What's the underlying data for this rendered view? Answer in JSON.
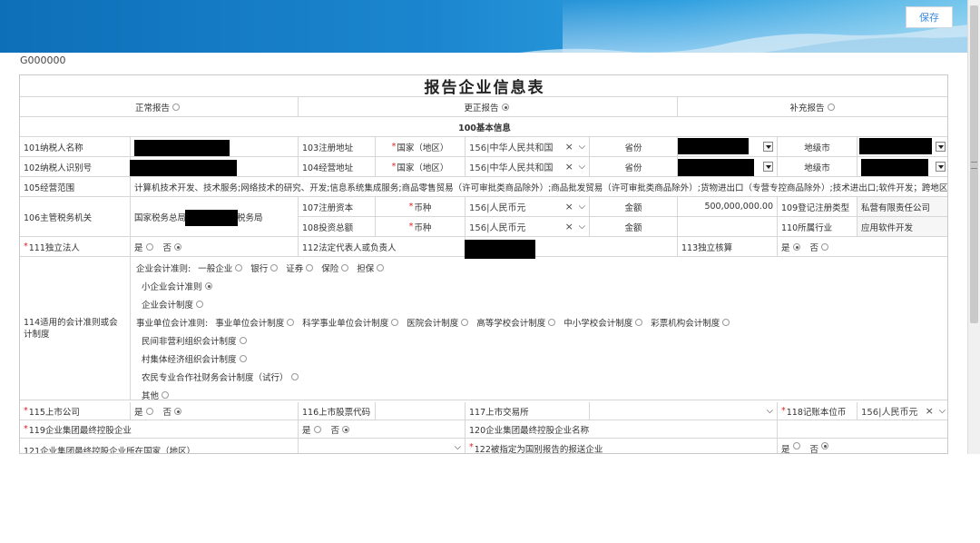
{
  "header": {
    "save_label": "保存"
  },
  "form_code": "G000000",
  "form": {
    "title": "报告企业信息表",
    "report_types": [
      "正常报告",
      "更正报告",
      "补充报告"
    ],
    "section_100": "100基本信息",
    "r101_label": "101纳税人名称",
    "r102_label": "102纳税人识别号",
    "r103_label": "103注册地址",
    "r104_label": "104经营地址",
    "country_label": "国家（地区）",
    "country_value": "156|中华人民共和国",
    "province_label": "省份",
    "city_label": "地级市",
    "r105_label": "105经营范围",
    "r105_value": "计算机技术开发、技术服务;网络技术的研究、开发;信息系统集成服务;商品零售贸易（许可审批类商品除外）;商品批发贸易（许可审批类商品除外）;货物进出口（专营专控商品除外）;技术进出口;软件开发；跨地区互",
    "r106_label": "106主管税务机关",
    "r106_prefix": "国家税务总局",
    "r106_suffix": "税务局",
    "r107_label": "107注册资本",
    "r108_label": "108投资总额",
    "currency_label": "币种",
    "currency_value": "156|人民币元",
    "amount_label": "金额",
    "r107_amount": "500,000,000.00",
    "r109_label": "109登记注册类型",
    "r109_value": "私营有限责任公司",
    "r110_label": "110所属行业",
    "r110_value": "应用软件开发",
    "r111_label": "111独立法人",
    "yes": "是",
    "no": "否",
    "r112_label": "112法定代表人或负责人",
    "r113_label": "113独立核算",
    "r114_label": "114适用的会计准则或会计制度",
    "std_enterprise_label": "企业会计准则:",
    "std_enterprise_opts": [
      "一般企业",
      "银行",
      "证券",
      "保险",
      "担保"
    ],
    "std_small": "小企业会计准则",
    "std_enterprise_system": "企业会计制度",
    "std_public_label": "事业单位会计准则:",
    "std_public_opts": [
      "事业单位会计制度",
      "科学事业单位会计制度",
      "医院会计制度",
      "高等学校会计制度",
      "中小学校会计制度",
      "彩票机构会计制度"
    ],
    "std_npo": "民间非营利组织会计制度",
    "std_village": "村集体经济组织会计制度",
    "std_coop": "农民专业合作社财务会计制度（试行）",
    "std_other": "其他",
    "r115_label": "115上市公司",
    "r116_label": "116上市股票代码",
    "r117_label": "117上市交易所",
    "r118_label": "118记账本位币",
    "r118_value": "156|人民币元",
    "r119_label": "119企业集团最终控股企业",
    "r120_label": "120企业集团最终控股企业名称",
    "r121_label": "121企业集团最终控股企业所在国家（地区）",
    "r122_label": "122被指定为国别报告的报送企业"
  }
}
